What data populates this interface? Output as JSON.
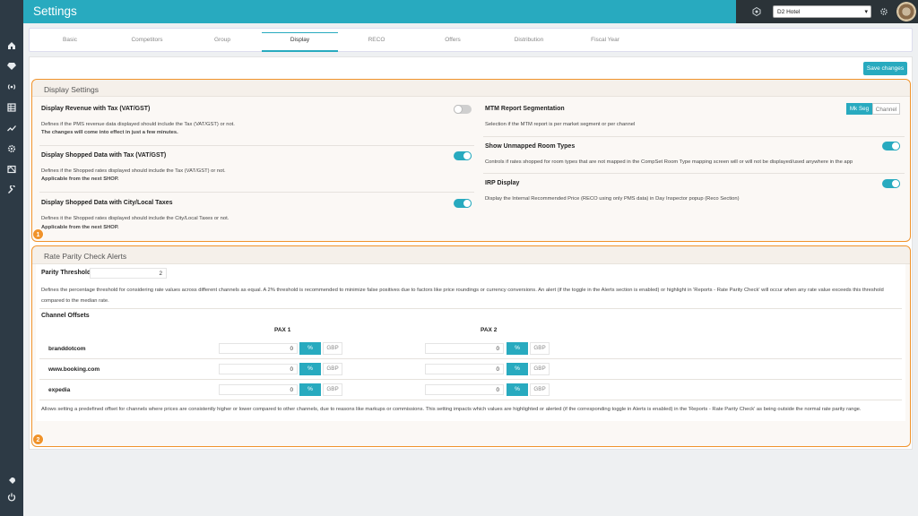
{
  "app": {
    "title": "Settings",
    "hotel_selected": "D2 Hotel"
  },
  "sidebar": {
    "icons": [
      "home-icon",
      "diamond-icon",
      "broadcast-icon",
      "table-icon",
      "trend-icon",
      "gear-icon",
      "image-icon",
      "wrench-icon",
      "rocket-icon",
      "power-icon"
    ]
  },
  "tabs": [
    {
      "label": "Basic"
    },
    {
      "label": "Competitors"
    },
    {
      "label": "Group"
    },
    {
      "label": "Display",
      "active": true
    },
    {
      "label": "RECO"
    },
    {
      "label": "Offers"
    },
    {
      "label": "Distribution"
    },
    {
      "label": "Fiscal Year"
    }
  ],
  "toolbar": {
    "save_label": "Save changes"
  },
  "display_settings": {
    "title": "Display Settings",
    "badge": "1",
    "left": [
      {
        "title": "Display Revenue with Tax (VAT/GST)",
        "desc": "Defines if the PMS revenue data displayed should include the Tax (VAT/GST) or not.",
        "note": "The changes will come into effect in just a few minutes.",
        "enabled": false
      },
      {
        "title": "Display Shopped Data with Tax (VAT/GST)",
        "desc": "Defines if the Shopped rates displayed should include the Tax (VAT/GST) or not.",
        "note": "Applicable from the next SHOP.",
        "enabled": true
      },
      {
        "title": "Display Shopped Data with City/Local Taxes",
        "desc": "Defines it the Shopped rates displayed should include the City/Local Taxes or not.",
        "note": "Applicable from the next SHOP.",
        "enabled": true
      }
    ],
    "mtm": {
      "title": "MTM Report Segmentation",
      "desc": "Selection if the MTM report is per market segment or per channel",
      "options": [
        "Mk Seg",
        "Channel"
      ],
      "selected": "Mk Seg"
    },
    "unmapped": {
      "title": "Show Unmapped Room Types",
      "desc": "Controls if rates shopped for room types that are not mapped in the CompSet Room Type mapping screen will or will not be displayed/used anywhere in the app",
      "enabled": true
    },
    "irp": {
      "title": "IRP Display",
      "desc": "Display the Internal Recommended Price (RECO using only PMS data) in Day Inspector popup (Reco Section)",
      "enabled": true
    }
  },
  "rate_parity": {
    "title": "Rate Parity Check Alerts",
    "badge": "2",
    "threshold_label": "Parity Threshold",
    "threshold_value": "2",
    "threshold_desc_1": "Defines the percentage threshold for considering rate values across different channels as equal. A 2% threshold is recommended to minimize false positives due to factors like price roundings or currency conversions. An alert (if the toggle in the Alerts section is enabled) or highlight in 'Reports - Rate Parity Check' will occur when any rate value exceeds this threshold",
    "threshold_desc_2": "compared to the median rate.",
    "offsets_label": "Channel Offsets",
    "pax_headers": [
      "PAX 1",
      "PAX 2"
    ],
    "channels": [
      {
        "name": "branddotcom",
        "pax1": "0",
        "pax2": "0"
      },
      {
        "name": "www.booking.com",
        "pax1": "0",
        "pax2": "0"
      },
      {
        "name": "expedia",
        "pax1": "0",
        "pax2": "0"
      }
    ],
    "pct_label": "%",
    "unit_label": "GBP",
    "offsets_desc": "Allows setting a predefined offset for channels where prices are consistently higher or lower compared to other channels, due to reasons like markups or commissions. This setting impacts which values are highlighted or alerted (if the corresponding toggle in Alerts is enabled) in the 'Reports - Rate Parity Check' as being outside the normal rate parity range."
  },
  "colors": {
    "accent": "#28aabf",
    "highlight": "#f0932b",
    "sidebar": "#2d3a45"
  }
}
